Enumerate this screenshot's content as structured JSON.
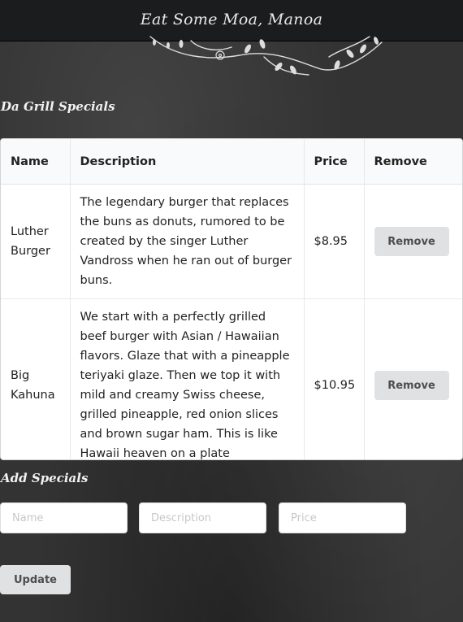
{
  "navbar": {
    "brand": "Eat Some Moa, Manoa"
  },
  "specials": {
    "title": "Da Grill Specials",
    "columns": [
      "Name",
      "Description",
      "Price",
      "Remove"
    ],
    "rows": [
      {
        "name": "Luther Burger",
        "description": "The legendary burger that replaces the buns as donuts, rumored to be created by the singer Luther Vandross when he ran out of burger buns.",
        "price": "$8.95",
        "remove_label": "Remove"
      },
      {
        "name": "Big Kahuna",
        "description": "We start with a perfectly grilled beef burger with Asian / Hawaiian flavors. Glaze that with a pineapple teriyaki glaze. Then we top it with mild and creamy Swiss cheese, grilled pineapple, red onion slices and brown sugar ham. This is like Hawaii heaven on a plate",
        "price": "$10.95",
        "remove_label": "Remove"
      }
    ]
  },
  "add_form": {
    "title": "Add Specials",
    "name_placeholder": "Name",
    "description_placeholder": "Description",
    "price_placeholder": "Price",
    "update_label": "Update"
  },
  "colors": {
    "chalkboard": "#333333",
    "navbar": "#1b1c1d",
    "button": "#e0e1e2"
  },
  "icons": {
    "decoration": "floral-vine-icon"
  }
}
